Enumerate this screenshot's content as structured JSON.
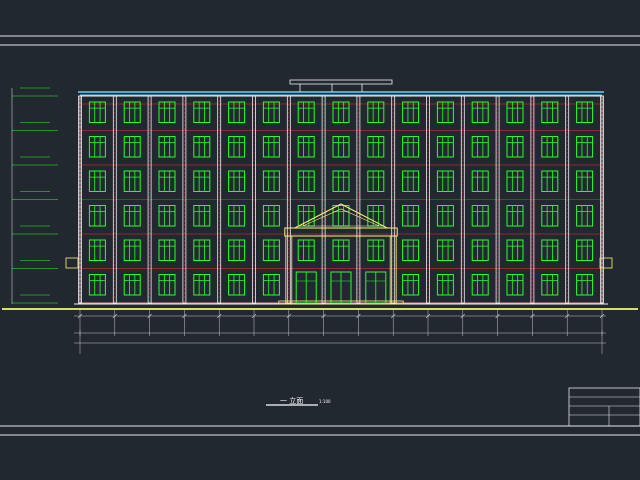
{
  "drawing": {
    "title": "一 立面",
    "scale": "1:100",
    "colors": {
      "background": "#212830",
      "frame": "#e8e8e8",
      "window": "#2bff2b",
      "column": "#f2f2f2",
      "floor_line": "#ff2a2a",
      "ground": "#d6e35a",
      "roof": "#57d6ff",
      "dimension": "#c8c8c8",
      "dim_text": "#ffffff",
      "level_mark": "#2bff2b",
      "pediment": "#fff07a"
    }
  },
  "building": {
    "floors": 6,
    "bays": 15
  }
}
